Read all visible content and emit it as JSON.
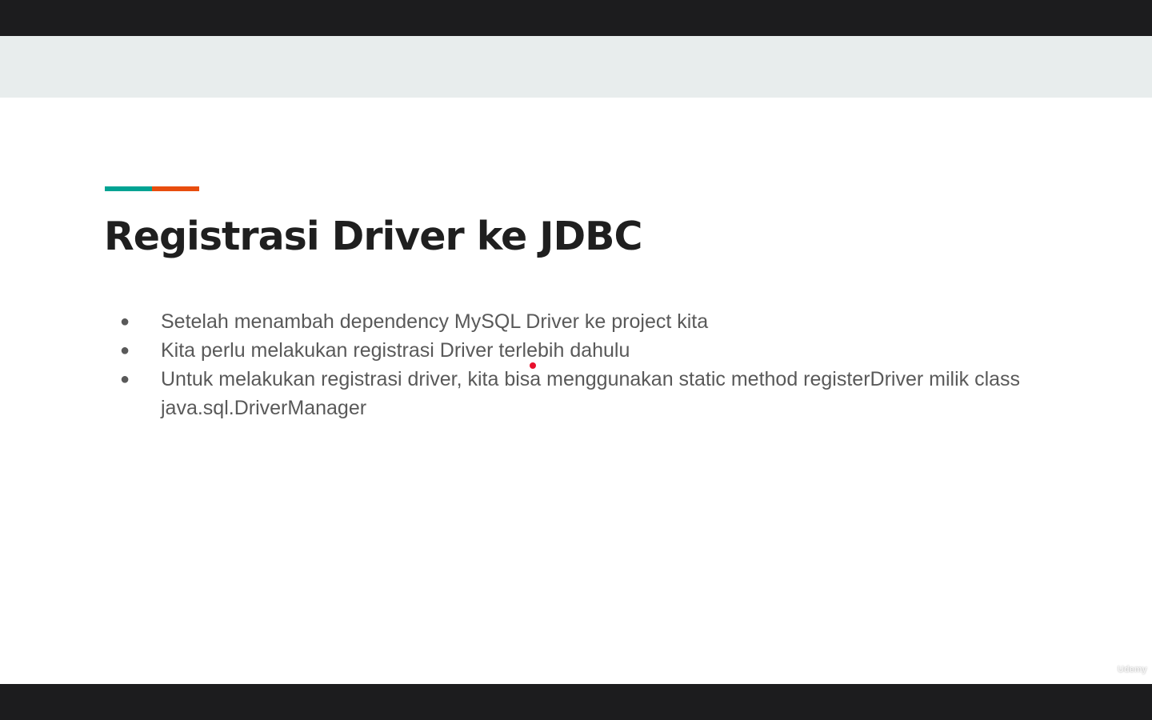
{
  "slide": {
    "title": "Registrasi Driver ke JDBC",
    "accent_colors": [
      "#00a393",
      "#e84d0e"
    ],
    "bullet_glyph": "●",
    "bullets": [
      "Setelah menambah dependency MySQL Driver ke project kita",
      "Kita perlu melakukan registrasi Driver terlebih dahulu",
      "Untuk melakukan registrasi driver, kita bisa menggunakan static method registerDriver milik class java.sql.DriverManager"
    ]
  },
  "overlay": {
    "laser_pointer_color": "#e8102d",
    "watermark_text": "Udemy",
    "watermark_icon": "udemy-logo-icon"
  }
}
